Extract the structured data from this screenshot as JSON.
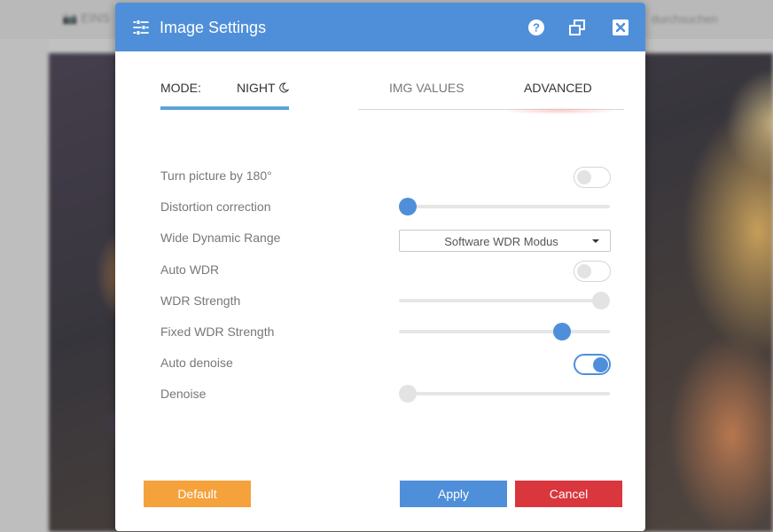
{
  "background": {
    "camera_label": "EINS",
    "search_hint": "durchsuchen"
  },
  "dialog": {
    "title": "Image Settings",
    "header_icons": [
      "sliders-icon",
      "help-icon",
      "restore-icon",
      "close-icon"
    ],
    "accent_color": "#4f8fd9"
  },
  "tabs": {
    "mode_label": "MODE:",
    "mode_value": "NIGHT",
    "mode_icon": "moon-icon",
    "img_values": "IMG VALUES",
    "advanced": "ADVANCED"
  },
  "settings": {
    "turn_picture": {
      "label": "Turn picture by 180°",
      "on": false
    },
    "distortion": {
      "label": "Distortion correction",
      "value_fraction": 0.0
    },
    "wdr": {
      "label": "Wide Dynamic Range",
      "selected": "Software WDR Modus"
    },
    "auto_wdr": {
      "label": "Auto WDR",
      "on": false
    },
    "wdr_strength": {
      "label": "WDR Strength",
      "value_fraction": 1.0,
      "disabled": true
    },
    "fixed_wdr_strength": {
      "label": "Fixed WDR Strength",
      "value_fraction": 0.8
    },
    "auto_denoise": {
      "label": "Auto denoise",
      "on": true
    },
    "denoise": {
      "label": "Denoise",
      "value_fraction": 0.0,
      "disabled": true
    }
  },
  "buttons": {
    "default": "Default",
    "apply": "Apply",
    "cancel": "Cancel"
  }
}
